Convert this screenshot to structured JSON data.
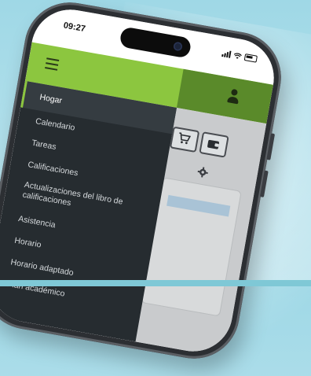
{
  "status_bar": {
    "time": "09:27"
  },
  "app_bar": {
    "menu_icon": "hamburger-icon",
    "user_icon": "user-icon",
    "accent_color": "#8cc63f"
  },
  "toolbar": {
    "cart_icon": "cart-icon",
    "wallet_icon": "wallet-icon",
    "settings_icon": "gear-icon"
  },
  "drawer": {
    "items": [
      {
        "label": "Hogar",
        "active": true
      },
      {
        "label": "Calendario"
      },
      {
        "label": "Tareas"
      },
      {
        "label": "Calificaciones"
      },
      {
        "label": "Actualizaciones del libro de calificaciones"
      },
      {
        "label": "Asistencia"
      },
      {
        "label": "Horario"
      },
      {
        "label": "Horario adaptado"
      },
      {
        "label": "Plan académico"
      }
    ]
  }
}
